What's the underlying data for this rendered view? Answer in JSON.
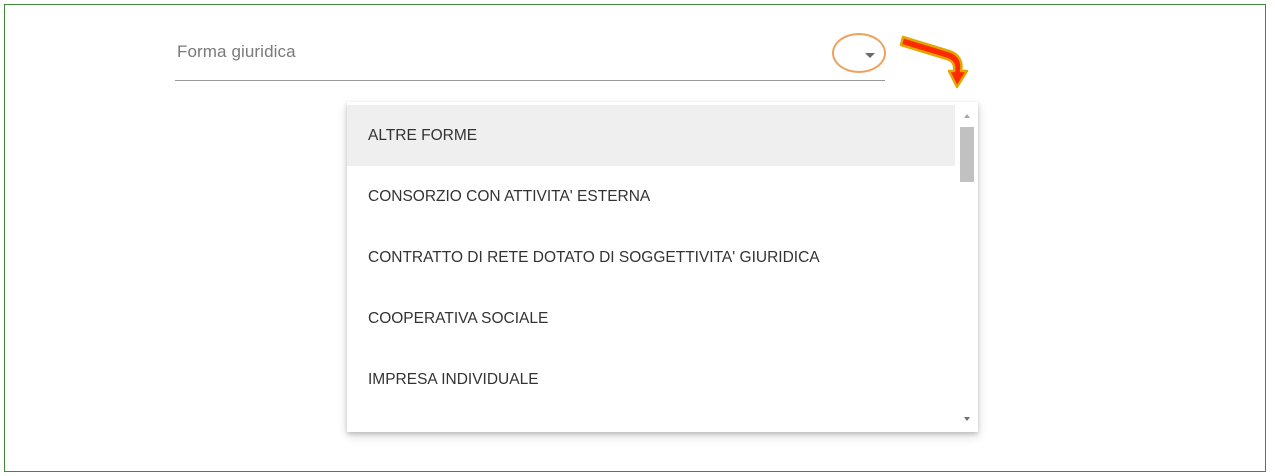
{
  "select": {
    "label": "Forma giuridica",
    "icon": "chevron-down-icon"
  },
  "annotation": {
    "circle_color": "#f0a15a",
    "arrow_fill": "#ff2a00",
    "arrow_outline": "#e0a800",
    "arrow_icon": "curved-arrow-icon"
  },
  "menu": {
    "items": [
      {
        "label": "ALTRE FORME"
      },
      {
        "label": "CONSORZIO CON ATTIVITA' ESTERNA"
      },
      {
        "label": "CONTRATTO DI RETE DOTATO DI SOGGETTIVITA' GIURIDICA"
      },
      {
        "label": "COOPERATIVA SOCIALE"
      },
      {
        "label": "IMPRESA INDIVIDUALE"
      },
      {
        "label": ""
      }
    ],
    "highlighted_index": 0
  },
  "colors": {
    "frame_border": "#3f8a3a",
    "highlight_bg": "#efefef"
  }
}
